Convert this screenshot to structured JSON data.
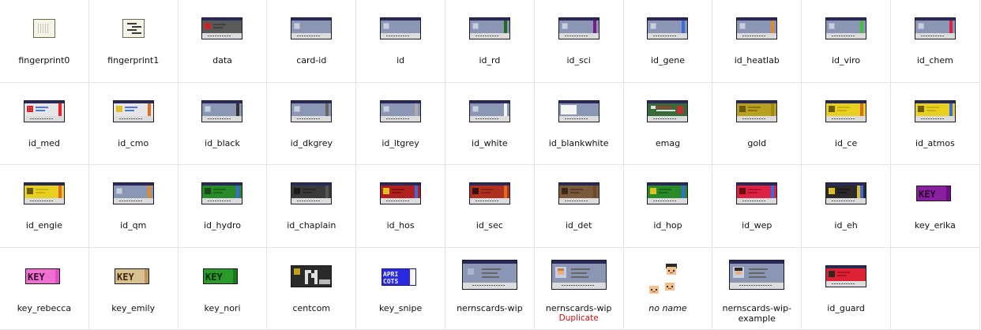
{
  "sprites": [
    {
      "label": "fingerprint0",
      "kind": "fp0"
    },
    {
      "label": "fingerprint1",
      "kind": "fp1"
    },
    {
      "label": "data",
      "kind": "card",
      "body": "#5a5a5a",
      "stripe": "#5a5a5a",
      "chip": "#cc2222",
      "accent": "#404040"
    },
    {
      "label": "card-id",
      "kind": "card",
      "body": "#8a96b4",
      "stripe": "#8a96b4",
      "accent": "#8a96b4"
    },
    {
      "label": "id",
      "kind": "card",
      "body": "#8a96b4",
      "stripe": "#8a96b4",
      "accent": "#8a96b4"
    },
    {
      "label": "id_rd",
      "kind": "card",
      "body": "#8a96b4",
      "stripe": "#1f6a1f",
      "accent": "#8a96b4"
    },
    {
      "label": "id_sci",
      "kind": "card",
      "body": "#8a96b4",
      "stripe": "#7a1c88",
      "accent": "#8a96b4"
    },
    {
      "label": "id_gene",
      "kind": "card",
      "body": "#8a96b4",
      "stripe": "#3a6ade",
      "accent": "#8a96b4"
    },
    {
      "label": "id_heatlab",
      "kind": "card",
      "body": "#8a96b4",
      "stripe": "#e08a2a",
      "accent": "#8a96b4"
    },
    {
      "label": "id_viro",
      "kind": "card",
      "body": "#8a96b4",
      "stripe": "#3ac23a",
      "accent": "#8a96b4"
    },
    {
      "label": "id_chem",
      "kind": "card",
      "body": "#8a96b4",
      "stripe": "#dd2244",
      "accent": "#8a96b4"
    },
    {
      "label": "id_med",
      "kind": "card",
      "body": "#e6e6ea",
      "stripe": "#e22",
      "chip": "#d22",
      "accent": "#4a7ad4",
      "cross": true
    },
    {
      "label": "id_cmo",
      "kind": "card",
      "body": "#e6e6ea",
      "stripe": "#e07020",
      "chip": "#e0c020",
      "accent": "#4a7ad4"
    },
    {
      "label": "id_black",
      "kind": "card",
      "body": "#8a96b4",
      "stripe": "#333333",
      "accent": "#8a96b4"
    },
    {
      "label": "id_dkgrey",
      "kind": "card",
      "body": "#8a96b4",
      "stripe": "#666666",
      "accent": "#8a96b4"
    },
    {
      "label": "id_ltgrey",
      "kind": "card",
      "body": "#8a96b4",
      "stripe": "#aaaaaa",
      "accent": "#8a96b4"
    },
    {
      "label": "id_white",
      "kind": "card",
      "body": "#8a96b4",
      "stripe": "#f4f4f4",
      "accent": "#8a96b4"
    },
    {
      "label": "id_blankwhite",
      "kind": "card",
      "body": "#8a96b4",
      "stripe": "#8a96b4",
      "accent": "#8a96b4",
      "blank": true
    },
    {
      "label": "emag",
      "kind": "card",
      "body": "#3a6a3a",
      "stripe": "#c03030",
      "accent": "#e0e0e0",
      "emag": true
    },
    {
      "label": "gold",
      "kind": "card",
      "body": "#b8a020",
      "stripe": "#a08a10",
      "chip": "#6a5a0a",
      "accent": "#8a7410"
    },
    {
      "label": "id_ce",
      "kind": "card",
      "body": "#e8d020",
      "stripe": "#e06a20",
      "chip": "#6a5a0a",
      "accent": "#c8b010"
    },
    {
      "label": "id_atmos",
      "kind": "card",
      "body": "#e8d020",
      "stripe": "#3a6ade",
      "chip": "#6a5a0a",
      "accent": "#c8b010"
    },
    {
      "label": "id_engie",
      "kind": "card",
      "body": "#e8d020",
      "stripe": "#e06a20",
      "chip": "#6a5a0a",
      "accent": "#c8b010"
    },
    {
      "label": "id_qm",
      "kind": "card",
      "body": "#8a96b4",
      "stripe": "#e08a2a",
      "accent": "#8a96b4"
    },
    {
      "label": "id_hydro",
      "kind": "card",
      "body": "#2a8a2a",
      "stripe": "#3a6ade",
      "chip": "#1a4a1a",
      "accent": "#1a6a1a"
    },
    {
      "label": "id_chaplain",
      "kind": "card",
      "body": "#3a3a3a",
      "stripe": "#555555",
      "chip": "#1a1a1a",
      "accent": "#2a2a2a"
    },
    {
      "label": "id_hos",
      "kind": "card",
      "body": "#b02020",
      "stripe": "#3a6ade",
      "chip": "#e0c020",
      "accent": "#8a1010"
    },
    {
      "label": "id_sec",
      "kind": "card",
      "body": "#b03020",
      "stripe": "#e06a20",
      "chip": "#3a1010",
      "accent": "#8a2010"
    },
    {
      "label": "id_det",
      "kind": "card",
      "body": "#7a5a3a",
      "stripe": "#6a4a2a",
      "chip": "#3a2a1a",
      "accent": "#5a3a2a"
    },
    {
      "label": "id_hop",
      "kind": "card",
      "body": "#2a8a2a",
      "stripe": "#3a6ade",
      "chip": "#e0c020",
      "accent": "#1a6a1a"
    },
    {
      "label": "id_wep",
      "kind": "card",
      "body": "#dd2244",
      "stripe": "#3a6ade",
      "chip": "#6a1010",
      "accent": "#b01030"
    },
    {
      "label": "id_eh",
      "kind": "card",
      "body": "#2a2a2a",
      "stripe": "#3a6ade",
      "chip": "#e0c020",
      "accent": "#1a1a1a",
      "stripe2": "#e0c020"
    },
    {
      "label": "key_erika",
      "kind": "key",
      "body": "#8a20a0",
      "text": "KEY",
      "textColor": "#2a0a30",
      "end": "#6a1080"
    },
    {
      "label": "key_rebecca",
      "kind": "key",
      "body": "#f070d0",
      "text": "KEY",
      "textColor": "#3a0a30",
      "end": "#e050c0"
    },
    {
      "label": "key_emily",
      "kind": "key",
      "body": "#d8c090",
      "text": "KEY",
      "textColor": "#3a2a10",
      "end": "#b89a60"
    },
    {
      "label": "key_nori",
      "kind": "key",
      "body": "#2a9a2a",
      "text": "KEY",
      "textColor": "#0a2a0a",
      "end": "#1a7a1a"
    },
    {
      "label": "centcom",
      "kind": "centcom"
    },
    {
      "label": "key_snipe",
      "kind": "snipe",
      "text1": "APRI",
      "text2": "COTS"
    },
    {
      "label": "nernscards-wip",
      "kind": "bigcard"
    },
    {
      "label": "nernscards-wip",
      "kind": "bigcard",
      "face": true,
      "note": "Duplicate"
    },
    {
      "label": "no name",
      "kind": "heads",
      "italic": true
    },
    {
      "label": "nernscards-wip-example",
      "kind": "bigcard",
      "face": true,
      "dark": true
    },
    {
      "label": "id_guard",
      "kind": "card",
      "body": "#dd2233",
      "stripe": "#dd2233",
      "chip": "#2a2a2a",
      "accent": "#b01020",
      "guard": true
    },
    {
      "label": "",
      "kind": "empty"
    }
  ]
}
